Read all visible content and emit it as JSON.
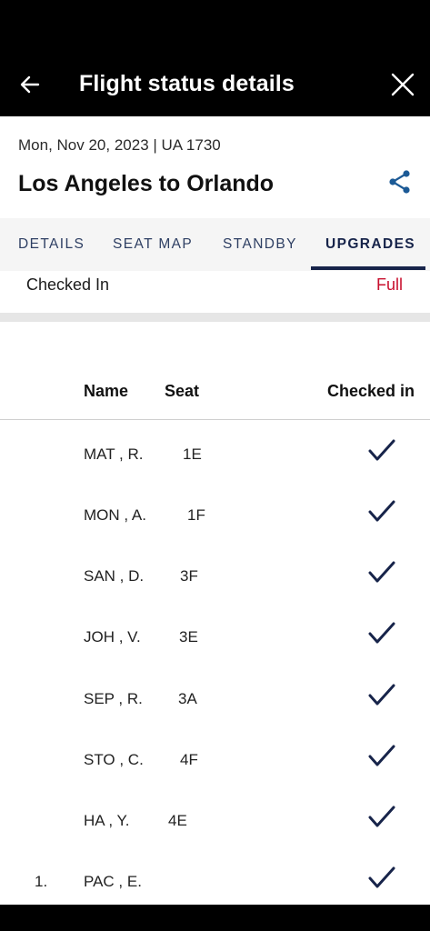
{
  "header": {
    "title": "Flight status details"
  },
  "flight": {
    "date_flight": "Mon, Nov 20, 2023 | UA 1730",
    "route": "Los Angeles to Orlando"
  },
  "tabs": [
    {
      "label": "DETAILS",
      "active": false
    },
    {
      "label": "SEAT MAP",
      "active": false
    },
    {
      "label": "STANDBY",
      "active": false
    },
    {
      "label": "UPGRADES",
      "active": true
    }
  ],
  "status": {
    "label": "Checked In",
    "value": "Full",
    "value_color": "#c8102e"
  },
  "table": {
    "headers": {
      "name": "Name",
      "seat": "Seat",
      "checked_in": "Checked in"
    },
    "rows": [
      {
        "num": "",
        "name": "MAT , R.",
        "seat": "1E",
        "checked_in": true
      },
      {
        "num": "",
        "name": "MON , A.",
        "seat": "1F",
        "checked_in": true
      },
      {
        "num": "",
        "name": "SAN , D.",
        "seat": "3F",
        "checked_in": true
      },
      {
        "num": "",
        "name": "JOH , V.",
        "seat": "3E",
        "checked_in": true
      },
      {
        "num": "",
        "name": "SEP , R.",
        "seat": "3A",
        "checked_in": true
      },
      {
        "num": "",
        "name": "STO , C.",
        "seat": "4F",
        "checked_in": true
      },
      {
        "num": "",
        "name": "HA , Y.",
        "seat": "4E",
        "checked_in": true
      },
      {
        "num": "1.",
        "name": "PAC , E.",
        "seat": "",
        "checked_in": true
      }
    ]
  },
  "colors": {
    "accent_navy": "#17244a",
    "alert_red": "#c8102e",
    "app_bar": "#000000"
  },
  "icons": {
    "back": "arrow-left-icon",
    "close": "close-icon",
    "share": "share-icon",
    "check": "checkmark-icon"
  }
}
